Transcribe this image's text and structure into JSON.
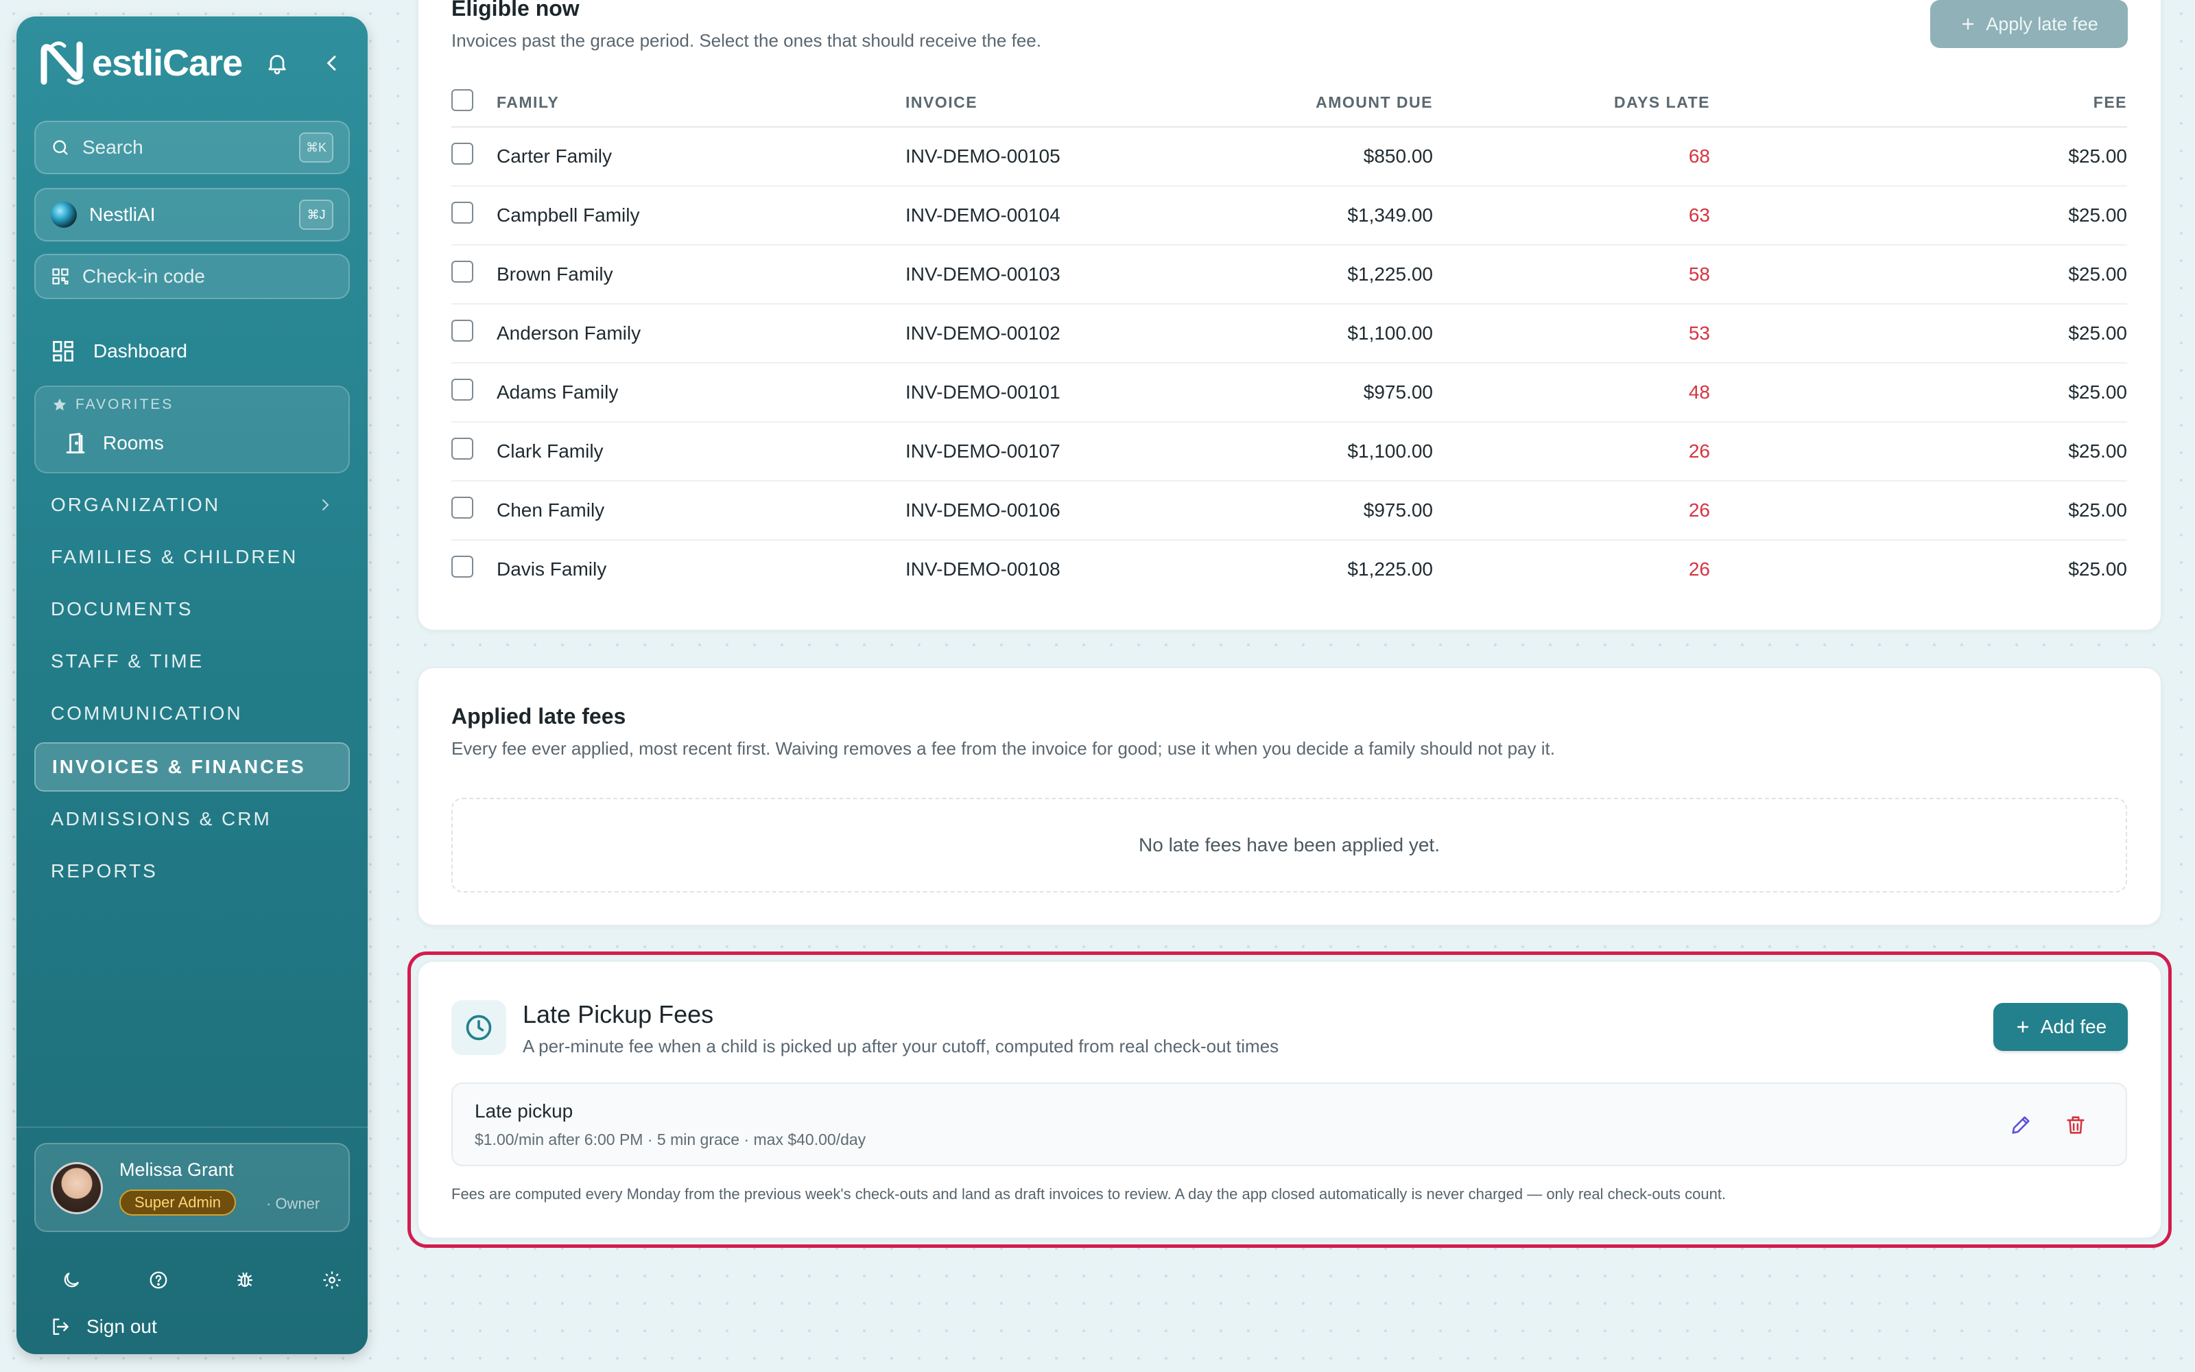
{
  "app": {
    "logo_text": "estliCare"
  },
  "sidebar": {
    "search": {
      "label": "Search",
      "shortcut": "⌘K"
    },
    "ai": {
      "label": "NestliAI",
      "shortcut": "⌘J"
    },
    "checkin": {
      "label": "Check-in code"
    },
    "dashboard": {
      "label": "Dashboard"
    },
    "favorites": {
      "heading": "FAVORITES",
      "items": [
        {
          "label": "Rooms"
        }
      ]
    },
    "nav": [
      {
        "label": "ORGANIZATION"
      },
      {
        "label": "FAMILIES & CHILDREN"
      },
      {
        "label": "DOCUMENTS"
      },
      {
        "label": "STAFF & TIME"
      },
      {
        "label": "COMMUNICATION"
      },
      {
        "label": "INVOICES & FINANCES"
      },
      {
        "label": "ADMISSIONS & CRM"
      },
      {
        "label": "REPORTS"
      }
    ],
    "user": {
      "name": "Melissa Grant",
      "role": "Super Admin",
      "extra": "· Owner"
    },
    "signout": {
      "label": "Sign out"
    }
  },
  "eligible": {
    "title": "Eligible now",
    "subtitle": "Invoices past the grace period. Select the ones that should receive the fee.",
    "apply_label": "Apply late fee",
    "headers": {
      "family": "FAMILY",
      "invoice": "INVOICE",
      "amount": "AMOUNT DUE",
      "days": "DAYS LATE",
      "fee": "FEE"
    },
    "rows": [
      {
        "family": "Carter Family",
        "invoice": "INV-DEMO-00105",
        "amount": "$850.00",
        "days": "68",
        "fee": "$25.00"
      },
      {
        "family": "Campbell Family",
        "invoice": "INV-DEMO-00104",
        "amount": "$1,349.00",
        "days": "63",
        "fee": "$25.00"
      },
      {
        "family": "Brown Family",
        "invoice": "INV-DEMO-00103",
        "amount": "$1,225.00",
        "days": "58",
        "fee": "$25.00"
      },
      {
        "family": "Anderson Family",
        "invoice": "INV-DEMO-00102",
        "amount": "$1,100.00",
        "days": "53",
        "fee": "$25.00"
      },
      {
        "family": "Adams Family",
        "invoice": "INV-DEMO-00101",
        "amount": "$975.00",
        "days": "48",
        "fee": "$25.00"
      },
      {
        "family": "Clark Family",
        "invoice": "INV-DEMO-00107",
        "amount": "$1,100.00",
        "days": "26",
        "fee": "$25.00"
      },
      {
        "family": "Chen Family",
        "invoice": "INV-DEMO-00106",
        "amount": "$975.00",
        "days": "26",
        "fee": "$25.00"
      },
      {
        "family": "Davis Family",
        "invoice": "INV-DEMO-00108",
        "amount": "$1,225.00",
        "days": "26",
        "fee": "$25.00"
      }
    ]
  },
  "applied": {
    "title": "Applied late fees",
    "subtitle": "Every fee ever applied, most recent first. Waiving removes a fee from the invoice for good; use it when you decide a family should not pay it.",
    "empty": "No late fees have been applied yet."
  },
  "pickup": {
    "title": "Late Pickup Fees",
    "subtitle": "A per-minute fee when a child is picked up after your cutoff, computed from real check-out times",
    "add_label": "Add fee",
    "item": {
      "name": "Late pickup",
      "detail": "$1.00/min after 6:00 PM · 5 min grace · max $40.00/day"
    },
    "note": "Fees are computed every Monday from the previous week's check-outs and land as draft invoices to review. A day the app closed automatically is never charged — only real check-outs count."
  },
  "colors": {
    "accent": "#23808d",
    "late_days": "#d63341",
    "highlight": "#d31c4f",
    "edit": "#5a4fd6",
    "delete": "#d63341"
  }
}
